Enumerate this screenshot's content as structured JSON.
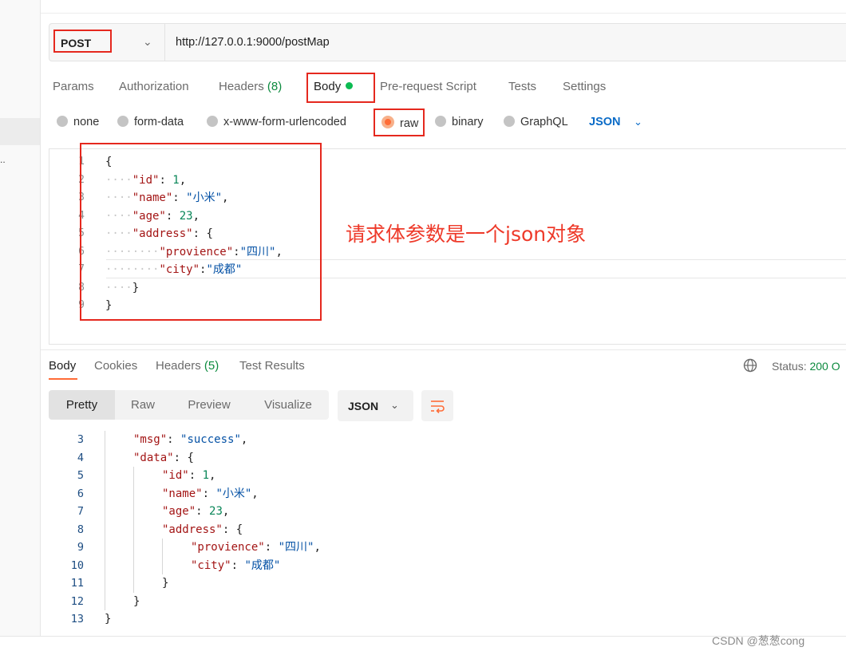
{
  "request": {
    "method": "POST",
    "url": "http://127.0.0.1:9000/postMap",
    "tabs": [
      {
        "label": "Params"
      },
      {
        "label": "Authorization"
      },
      {
        "label": "Headers",
        "count": "(8)"
      },
      {
        "label": "Body"
      },
      {
        "label": "Pre-request Script"
      },
      {
        "label": "Tests"
      },
      {
        "label": "Settings"
      }
    ],
    "body_types": [
      "none",
      "form-data",
      "x-www-form-urlencoded",
      "raw",
      "binary",
      "GraphQL"
    ],
    "selected_body_type": "raw",
    "format": "JSON",
    "line_numbers": [
      "1",
      "2",
      "3",
      "4",
      "5",
      "6",
      "7",
      "8",
      "9"
    ],
    "body_code": [
      {
        "indent": "",
        "parts": [
          {
            "t": "{",
            "c": "punc"
          }
        ]
      },
      {
        "indent": "····",
        "parts": [
          {
            "t": "\"id\"",
            "c": "key"
          },
          {
            "t": ": ",
            "c": "punc"
          },
          {
            "t": "1",
            "c": "num"
          },
          {
            "t": ",",
            "c": "punc"
          }
        ]
      },
      {
        "indent": "····",
        "parts": [
          {
            "t": "\"name\"",
            "c": "key"
          },
          {
            "t": ": ",
            "c": "punc"
          },
          {
            "t": "\"小米\"",
            "c": "str"
          },
          {
            "t": ",",
            "c": "punc"
          }
        ]
      },
      {
        "indent": "····",
        "parts": [
          {
            "t": "\"age\"",
            "c": "key"
          },
          {
            "t": ": ",
            "c": "punc"
          },
          {
            "t": "23",
            "c": "num"
          },
          {
            "t": ",",
            "c": "punc"
          }
        ]
      },
      {
        "indent": "····",
        "parts": [
          {
            "t": "\"address\"",
            "c": "key"
          },
          {
            "t": ": ",
            "c": "punc"
          },
          {
            "t": "{",
            "c": "punc"
          }
        ]
      },
      {
        "indent": "········",
        "parts": [
          {
            "t": "\"provience\"",
            "c": "key"
          },
          {
            "t": ":",
            "c": "punc"
          },
          {
            "t": "\"四川\"",
            "c": "str"
          },
          {
            "t": ",",
            "c": "punc"
          }
        ]
      },
      {
        "indent": "········",
        "parts": [
          {
            "t": "\"city\"",
            "c": "key"
          },
          {
            "t": ":",
            "c": "punc"
          },
          {
            "t": "\"成都\"",
            "c": "str"
          }
        ]
      },
      {
        "indent": "····",
        "parts": [
          {
            "t": "}",
            "c": "punc"
          }
        ]
      },
      {
        "indent": "",
        "parts": [
          {
            "t": "}",
            "c": "punc"
          }
        ]
      }
    ]
  },
  "annotation": "请求体参数是一个json对象",
  "response": {
    "tabs": [
      {
        "label": "Body"
      },
      {
        "label": "Cookies"
      },
      {
        "label": "Headers",
        "count": "(5)"
      },
      {
        "label": "Test Results"
      }
    ],
    "status_label": "Status:",
    "status_value": "200 O",
    "views": [
      "Pretty",
      "Raw",
      "Preview",
      "Visualize"
    ],
    "format": "JSON",
    "lines": [
      {
        "n": "3",
        "indent": 1,
        "parts": [
          {
            "t": "\"msg\"",
            "c": "key"
          },
          {
            "t": ": ",
            "c": "punc"
          },
          {
            "t": "\"success\"",
            "c": "str"
          },
          {
            "t": ",",
            "c": "punc"
          }
        ]
      },
      {
        "n": "4",
        "indent": 1,
        "parts": [
          {
            "t": "\"data\"",
            "c": "key"
          },
          {
            "t": ": ",
            "c": "punc"
          },
          {
            "t": "{",
            "c": "punc"
          }
        ]
      },
      {
        "n": "5",
        "indent": 2,
        "parts": [
          {
            "t": "\"id\"",
            "c": "key"
          },
          {
            "t": ": ",
            "c": "punc"
          },
          {
            "t": "1",
            "c": "num"
          },
          {
            "t": ",",
            "c": "punc"
          }
        ]
      },
      {
        "n": "6",
        "indent": 2,
        "parts": [
          {
            "t": "\"name\"",
            "c": "key"
          },
          {
            "t": ": ",
            "c": "punc"
          },
          {
            "t": "\"小米\"",
            "c": "str"
          },
          {
            "t": ",",
            "c": "punc"
          }
        ]
      },
      {
        "n": "7",
        "indent": 2,
        "parts": [
          {
            "t": "\"age\"",
            "c": "key"
          },
          {
            "t": ": ",
            "c": "punc"
          },
          {
            "t": "23",
            "c": "num"
          },
          {
            "t": ",",
            "c": "punc"
          }
        ]
      },
      {
        "n": "8",
        "indent": 2,
        "parts": [
          {
            "t": "\"address\"",
            "c": "key"
          },
          {
            "t": ": ",
            "c": "punc"
          },
          {
            "t": "{",
            "c": "punc"
          }
        ]
      },
      {
        "n": "9",
        "indent": 3,
        "parts": [
          {
            "t": "\"provience\"",
            "c": "key"
          },
          {
            "t": ": ",
            "c": "punc"
          },
          {
            "t": "\"四川\"",
            "c": "str"
          },
          {
            "t": ",",
            "c": "punc"
          }
        ]
      },
      {
        "n": "10",
        "indent": 3,
        "parts": [
          {
            "t": "\"city\"",
            "c": "key"
          },
          {
            "t": ": ",
            "c": "punc"
          },
          {
            "t": "\"成都\"",
            "c": "str"
          }
        ]
      },
      {
        "n": "11",
        "indent": 2,
        "parts": [
          {
            "t": "}",
            "c": "punc"
          }
        ]
      },
      {
        "n": "12",
        "indent": 1,
        "parts": [
          {
            "t": "}",
            "c": "punc"
          }
        ]
      },
      {
        "n": "13",
        "indent": 0,
        "parts": [
          {
            "t": "}",
            "c": "punc"
          }
        ]
      }
    ]
  },
  "sidebar": {
    "dots": ".."
  },
  "watermark": "CSDN @葱葱cong",
  "colors": {
    "accent": "#ff6c37",
    "highlight": "#e5281e",
    "success": "#0c8a3e",
    "link": "#0a6bc7"
  }
}
